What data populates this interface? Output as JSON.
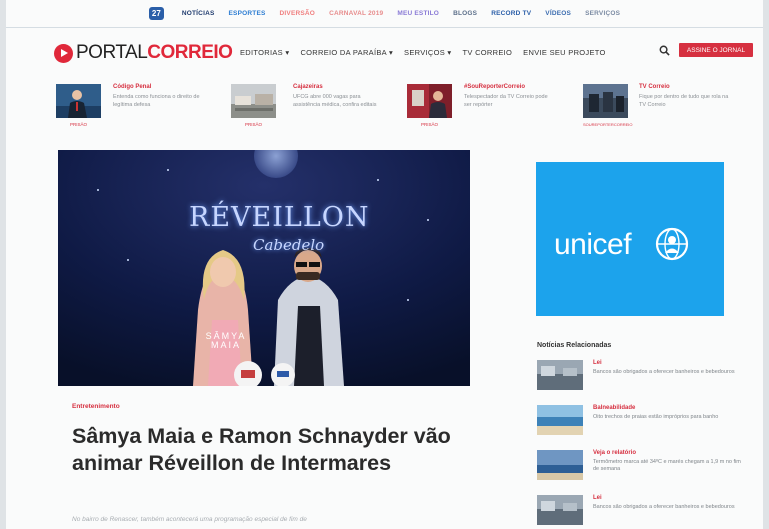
{
  "topnav": {
    "badge": "27",
    "items": [
      {
        "label": "NOTÍCIAS",
        "color": "#1f3b6e"
      },
      {
        "label": "ESPORTES",
        "color": "#2d7dd2"
      },
      {
        "label": "DIVERSÃO",
        "color": "#f07f7f"
      },
      {
        "label": "CARNAVAL 2019",
        "color": "#e78c8c"
      },
      {
        "label": "MEU ESTILO",
        "color": "#8a7bd6"
      },
      {
        "label": "BLOGS",
        "color": "#5c6f8a"
      },
      {
        "label": "RECORD TV",
        "color": "#2a5ea8"
      },
      {
        "label": "VÍDEOS",
        "color": "#3c6db0"
      },
      {
        "label": "SERVIÇOS",
        "color": "#7b8ba3"
      }
    ]
  },
  "header": {
    "logo_part1": "PORTAL",
    "logo_part2": "CORREIO",
    "nav": [
      "EDITORIAS ▾",
      "CORREIO DA PARAÍBA ▾",
      "SERVIÇOS ▾",
      "TV CORREIO",
      "ENVIE SEU PROJETO"
    ],
    "subscribe_label": "ASSINE O JORNAL",
    "accent_color": "#d63040",
    "search_icon": "search-icon"
  },
  "highlights": [
    {
      "title": "Código Penal",
      "desc": "Entenda como funciona o direito de legítima defesa",
      "tag": "PRISÃO"
    },
    {
      "title": "Cajazeiras",
      "desc": "UFCG abre 000 vagas para assistência médica, confira editais",
      "tag": "PRISÃO"
    },
    {
      "title": "#SouReporterCorreio",
      "desc": "Telespectador da TV Correio pode ser repórter",
      "tag": "PRISÃO"
    },
    {
      "title": "TV Correio",
      "desc": "Fique por dentro de tudo que rola na TV Correio",
      "tag": "SOUREPORTERCORREIO"
    }
  ],
  "hero": {
    "graphic_line1": "RÉVEILLON",
    "graphic_line2": "Cabedelo",
    "graphic_name": "SÂMYA MAIA"
  },
  "article": {
    "category": "Entretenimento",
    "headline": "Sâmya Maia e Ramon Schnayder vão animar Réveillon de Intermares",
    "lead": "No bairro de Renascer, também acontecerá uma programação especial de fim de"
  },
  "sidebar": {
    "ad_text": "unicef",
    "ad_color": "#1ca3ec",
    "related_title": "Notícias Relacionadas",
    "related": [
      {
        "title": "Lei",
        "desc": "Bancos são obrigados a oferecer banheiros e bebedouros"
      },
      {
        "title": "Balneabilidade",
        "desc": "Oito trechos de praias estão impróprios para banho"
      },
      {
        "title": "Veja o relatório",
        "desc": "Termômetro marca até 34ºC e marés chegam a 1,9 m no fim de semana"
      },
      {
        "title": "Lei",
        "desc": "Bancos são obrigados a oferecer banheiros e bebedouros"
      }
    ]
  }
}
